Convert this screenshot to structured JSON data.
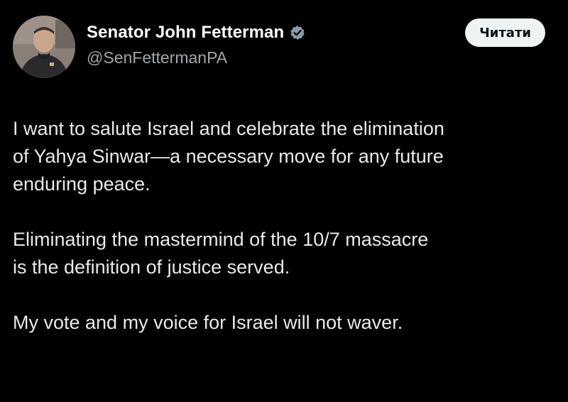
{
  "author": {
    "display_name": "Senator John Fetterman",
    "handle": "@SenFettermanPA",
    "avatar_icon": "profile-photo",
    "verified_icon": "verified-badge-icon",
    "verified_color": "#8b98a5"
  },
  "actions": {
    "follow_label": "Читати"
  },
  "post": {
    "paragraphs": [
      {
        "lines": [
          "I want to salute Israel and celebrate the elimination",
          "of Yahya Sinwar—a necessary move for any future",
          "enduring peace."
        ]
      },
      {
        "lines": [
          "Eliminating the mastermind of the 10/7 massacre",
          "is the definition of justice served."
        ]
      },
      {
        "lines": [
          "My vote and my voice for Israel will not waver."
        ]
      }
    ]
  },
  "colors": {
    "background": "#000000",
    "text": "#e7e9ea",
    "muted": "#a1a6ab",
    "button_bg": "#eff3f4",
    "button_text": "#0f1419"
  }
}
